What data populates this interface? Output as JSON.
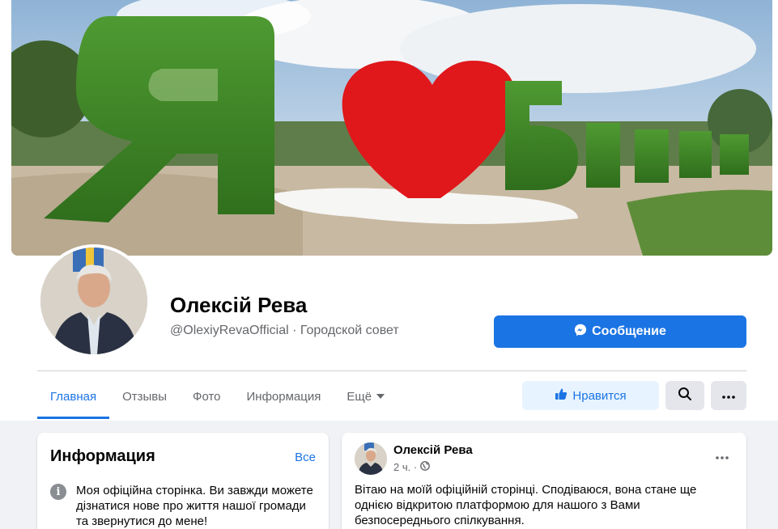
{
  "profile": {
    "name": "Олексій Рева",
    "subtitle": "@OlexiyRevaOfficial · Городской совет"
  },
  "actions": {
    "message_label": "Сообщение",
    "like_label": "Нравится"
  },
  "tabs": [
    {
      "label": "Главная",
      "active": true
    },
    {
      "label": "Отзывы"
    },
    {
      "label": "Фото"
    },
    {
      "label": "Информация"
    },
    {
      "label": "Ещё"
    }
  ],
  "info_card": {
    "title": "Информация",
    "all_link": "Все",
    "text": "Моя офіційна сторінка. Ви завжди можете дізнатися нове про життя нашої громади та звернутися до мене!"
  },
  "post": {
    "author": "Олексій Рева",
    "time": "2 ч. ·",
    "text": "Вітаю на моїй офіційній сторінці. Сподіваюся, вона стане ще однією відкритою платформою для нашого з Вами безпосереднього спілкування."
  },
  "colors": {
    "accent": "#1b74e4",
    "background": "#f0f2f5",
    "cover_heart": "#e0171b",
    "cover_letters": "#3f8a2a"
  },
  "icons": [
    "messenger-icon",
    "thumbs-up-icon",
    "search-icon",
    "more-icon",
    "info-icon",
    "globe-icon",
    "caret-down-icon"
  ]
}
